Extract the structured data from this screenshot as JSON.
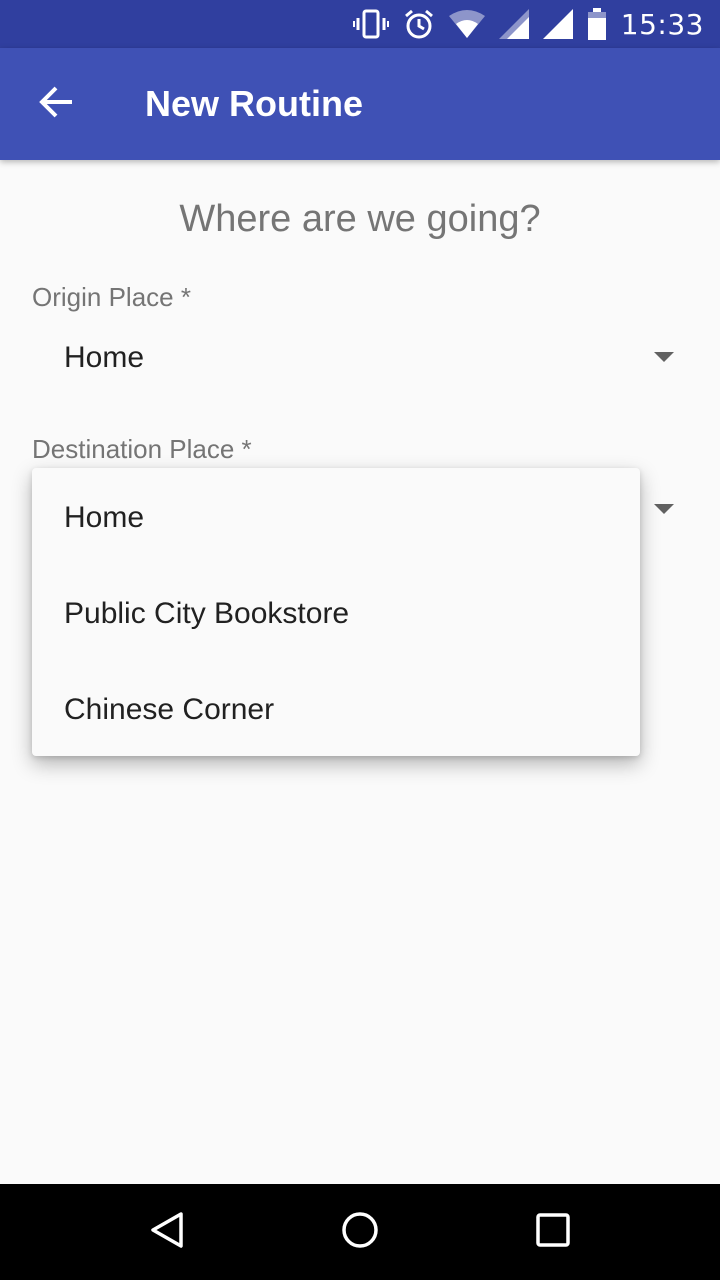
{
  "status_bar": {
    "time": "15:33",
    "icons": [
      "vibrate-icon",
      "alarm-icon",
      "wifi-icon",
      "signal-icon",
      "signal-icon",
      "battery-icon"
    ]
  },
  "app_bar": {
    "title": "New Routine",
    "back_icon": "arrow-back-icon"
  },
  "main": {
    "heading": "Where are we going?",
    "origin": {
      "label": "Origin Place *",
      "value": "Home"
    },
    "destination": {
      "label": "Destination Place *"
    }
  },
  "dropdown": {
    "items": [
      "Home",
      "Public City Bookstore",
      "Chinese Corner"
    ]
  },
  "nav_bar": {
    "icons": [
      "back-triangle-icon",
      "home-circle-icon",
      "recents-square-icon"
    ]
  },
  "colors": {
    "status_bar": "#303f9f",
    "app_bar": "#3f51b5",
    "background": "#fafafa"
  }
}
